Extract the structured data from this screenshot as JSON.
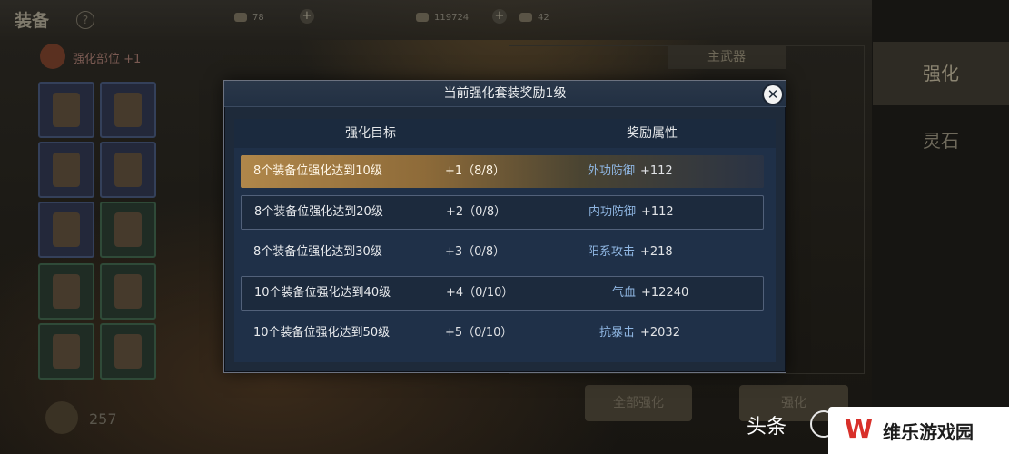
{
  "background": {
    "title": "装备",
    "help": "?",
    "resources": [
      "78",
      "119724",
      "42"
    ],
    "enhance_label": "强化部位 +1",
    "tabs": [
      "强化",
      "灵石"
    ],
    "bottom_count": "257",
    "bottom_buttons": [
      "全部强化",
      "强化"
    ],
    "panel_header": "主武器"
  },
  "dialog": {
    "title": "当前强化套装奖励1级",
    "close": "✕",
    "columns": {
      "target": "强化目标",
      "reward": "奖励属性"
    },
    "rows": [
      {
        "goal": "8个装备位强化达到10级",
        "level": "+1（8/8）",
        "attr": "外功防御",
        "value": "+112",
        "state": "active"
      },
      {
        "goal": "8个装备位强化达到20级",
        "level": "+2（0/8）",
        "attr": "内功防御",
        "value": "+112",
        "state": "outline"
      },
      {
        "goal": "8个装备位强化达到30级",
        "level": "+3（0/8）",
        "attr": "阳系攻击",
        "value": "+218",
        "state": "plain"
      },
      {
        "goal": "10个装备位强化达到40级",
        "level": "+4（0/10）",
        "attr": "气血",
        "value": "+12240",
        "state": "outline"
      },
      {
        "goal": "10个装备位强化达到50级",
        "level": "+5（0/10）",
        "attr": "抗暴击",
        "value": "+2032",
        "state": "plain"
      }
    ]
  },
  "watermark": {
    "left_text": "头条",
    "logo": "W",
    "site": "维乐游戏园"
  },
  "colors": {
    "active_row": "#b0874a",
    "attr_text": "#8fb6e2",
    "dialog_bg": "#1f3048"
  }
}
